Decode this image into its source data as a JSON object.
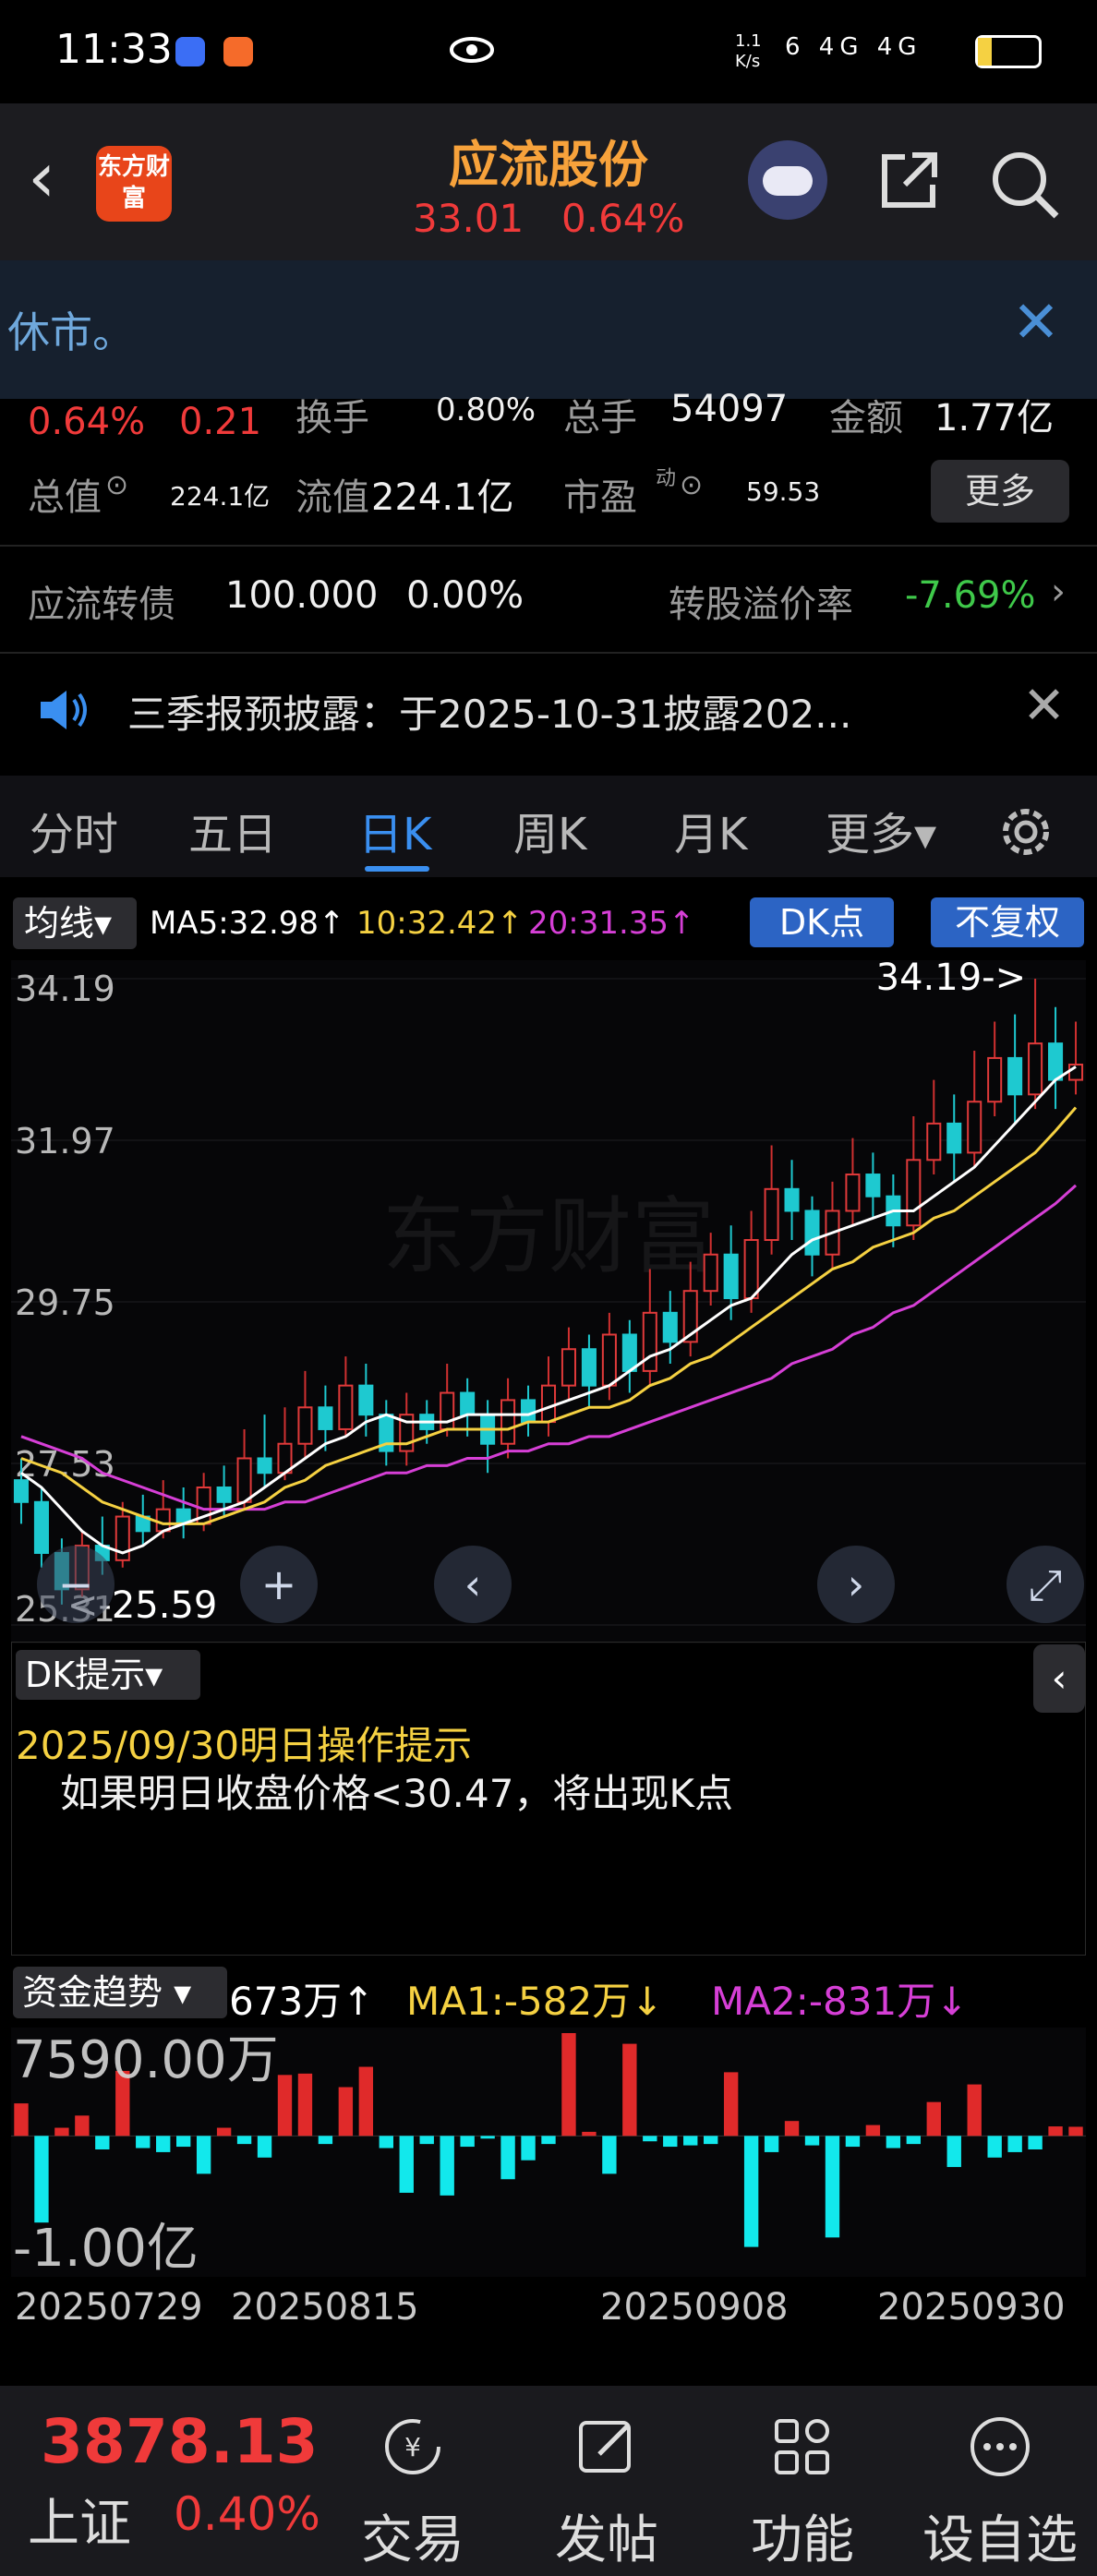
{
  "status_bar": {
    "time": "11:33",
    "net_speed": "1.1 K/s",
    "signal": "6 4G 4G",
    "battery": "20"
  },
  "header": {
    "back_label": "‹",
    "logo_text": "东方财富",
    "stock_name": "应流股份",
    "price": "33.01",
    "change_pct": "0.64%"
  },
  "notice": {
    "text": "休市。",
    "close_label": "✕"
  },
  "quote": {
    "change_pct": "0.64%",
    "change_amt": "0.21",
    "turnover_label": "换手",
    "turnover": "0.80%",
    "volume_label": "总手",
    "volume": "54097",
    "amount_label": "金额",
    "amount": "1.77亿",
    "mktcap_label": "总值",
    "mktcap": "224.1亿",
    "float_label": "流值",
    "float_val": "224.1亿",
    "pe_label": "市盈",
    "pe_sup": "动",
    "pe": "59.53",
    "more_label": "更多"
  },
  "bond": {
    "name": "应流转债",
    "price": "100.000",
    "pct": "0.00%",
    "premium_label": "转股溢价率",
    "premium": "-7.69%",
    "arrow": "›"
  },
  "news": {
    "text": "三季报预披露：于2025-10-31披露202...",
    "close_label": "✕"
  },
  "tabs": [
    {
      "label": "分时"
    },
    {
      "label": "五日"
    },
    {
      "label": "日K"
    },
    {
      "label": "周K"
    },
    {
      "label": "月K"
    },
    {
      "label": "更多▾"
    }
  ],
  "ma_bar": {
    "selector": "均线▾",
    "ma5": "MA5:32.98↑",
    "ma10": "10:32.42↑",
    "ma20": "20:31.35↑",
    "dk_label": "DK点",
    "fq_label": "不复权",
    "colors": {
      "ma5": "#ffffff",
      "ma10": "#f5d142",
      "ma20": "#d63fd6"
    }
  },
  "chart_data": [
    {
      "type": "candlestick",
      "y_ticks": [
        "34.19",
        "31.97",
        "29.75",
        "27.53",
        "25.31"
      ],
      "ylim": [
        25.31,
        34.19
      ],
      "high_label": "34.19->",
      "low_label": "<-25.59",
      "watermark": "东方财富",
      "candles": [
        [
          27.3,
          27.0,
          27.6,
          26.7
        ],
        [
          27.0,
          26.3,
          27.2,
          26.1
        ],
        [
          26.3,
          25.8,
          26.5,
          25.59
        ],
        [
          25.8,
          26.4,
          26.6,
          25.7
        ],
        [
          26.4,
          26.2,
          26.8,
          26.0
        ],
        [
          26.2,
          26.8,
          27.0,
          26.1
        ],
        [
          26.8,
          26.6,
          27.1,
          26.4
        ],
        [
          26.6,
          26.9,
          27.3,
          26.5
        ],
        [
          26.9,
          26.7,
          27.2,
          26.5
        ],
        [
          26.7,
          27.2,
          27.4,
          26.6
        ],
        [
          27.2,
          27.0,
          27.5,
          26.8
        ],
        [
          27.0,
          27.6,
          28.0,
          26.9
        ],
        [
          27.6,
          27.4,
          28.2,
          27.2
        ],
        [
          27.4,
          27.8,
          28.3,
          27.3
        ],
        [
          27.8,
          28.3,
          28.8,
          27.6
        ],
        [
          28.3,
          28.0,
          28.6,
          27.7
        ],
        [
          28.0,
          28.6,
          29.0,
          27.9
        ],
        [
          28.6,
          28.2,
          28.9,
          27.9
        ],
        [
          28.2,
          27.7,
          28.4,
          27.5
        ],
        [
          27.7,
          28.2,
          28.5,
          27.5
        ],
        [
          28.2,
          28.0,
          28.4,
          27.8
        ],
        [
          28.0,
          28.5,
          28.9,
          27.9
        ],
        [
          28.5,
          28.2,
          28.7,
          27.9
        ],
        [
          28.2,
          27.8,
          28.4,
          27.4
        ],
        [
          27.8,
          28.4,
          28.7,
          27.6
        ],
        [
          28.4,
          28.1,
          28.6,
          27.9
        ],
        [
          28.1,
          28.6,
          29.0,
          27.9
        ],
        [
          28.6,
          29.1,
          29.4,
          28.4
        ],
        [
          29.1,
          28.6,
          29.3,
          28.3
        ],
        [
          28.6,
          29.3,
          29.6,
          28.4
        ],
        [
          29.3,
          28.8,
          29.5,
          28.5
        ],
        [
          28.8,
          29.6,
          30.2,
          28.6
        ],
        [
          29.6,
          29.2,
          29.9,
          28.9
        ],
        [
          29.2,
          29.9,
          30.3,
          29.0
        ],
        [
          29.9,
          30.4,
          30.7,
          29.7
        ],
        [
          30.4,
          29.8,
          30.8,
          29.5
        ],
        [
          29.8,
          30.6,
          31.0,
          29.6
        ],
        [
          30.6,
          31.3,
          31.9,
          30.4
        ],
        [
          31.3,
          31.0,
          31.7,
          30.6
        ],
        [
          31.0,
          30.4,
          31.2,
          30.1
        ],
        [
          30.4,
          31.0,
          31.4,
          30.2
        ],
        [
          31.0,
          31.5,
          32.0,
          30.8
        ],
        [
          31.5,
          31.2,
          31.8,
          30.9
        ],
        [
          31.2,
          30.8,
          31.5,
          30.5
        ],
        [
          30.8,
          31.7,
          32.3,
          30.6
        ],
        [
          31.7,
          32.2,
          32.8,
          31.5
        ],
        [
          32.2,
          31.8,
          32.6,
          31.4
        ],
        [
          31.8,
          32.5,
          33.2,
          31.6
        ],
        [
          32.5,
          33.1,
          33.6,
          32.3
        ],
        [
          33.1,
          32.6,
          33.7,
          32.2
        ],
        [
          32.6,
          33.3,
          34.19,
          32.4
        ],
        [
          33.3,
          32.8,
          33.8,
          32.4
        ],
        [
          32.8,
          33.01,
          33.6,
          32.6
        ]
      ],
      "ma5": [
        27.4,
        27.2,
        26.9,
        26.6,
        26.4,
        26.3,
        26.4,
        26.6,
        26.7,
        26.8,
        26.9,
        27.0,
        27.2,
        27.4,
        27.6,
        27.8,
        27.9,
        28.1,
        28.2,
        28.1,
        28.1,
        28.1,
        28.2,
        28.2,
        28.2,
        28.2,
        28.3,
        28.4,
        28.5,
        28.6,
        28.8,
        29.0,
        29.1,
        29.3,
        29.5,
        29.7,
        29.8,
        30.1,
        30.4,
        30.6,
        30.7,
        30.8,
        30.9,
        31.0,
        31.0,
        31.2,
        31.4,
        31.6,
        31.9,
        32.2,
        32.5,
        32.8,
        32.98
      ],
      "ma10": [
        27.6,
        27.5,
        27.4,
        27.2,
        27.0,
        26.9,
        26.8,
        26.7,
        26.7,
        26.7,
        26.8,
        26.9,
        27.0,
        27.2,
        27.3,
        27.5,
        27.6,
        27.7,
        27.8,
        27.8,
        27.9,
        28.0,
        28.0,
        28.0,
        28.0,
        28.1,
        28.1,
        28.2,
        28.3,
        28.3,
        28.4,
        28.6,
        28.7,
        28.9,
        29.0,
        29.2,
        29.4,
        29.6,
        29.8,
        30.0,
        30.2,
        30.3,
        30.5,
        30.6,
        30.7,
        30.9,
        31.0,
        31.2,
        31.4,
        31.6,
        31.8,
        32.1,
        32.42
      ],
      "ma20": [
        27.9,
        27.8,
        27.7,
        27.6,
        27.4,
        27.3,
        27.2,
        27.1,
        27.0,
        26.9,
        26.9,
        26.9,
        26.9,
        27.0,
        27.0,
        27.1,
        27.2,
        27.3,
        27.4,
        27.4,
        27.5,
        27.5,
        27.6,
        27.6,
        27.7,
        27.7,
        27.8,
        27.8,
        27.9,
        27.9,
        28.0,
        28.1,
        28.2,
        28.3,
        28.4,
        28.5,
        28.6,
        28.7,
        28.9,
        29.0,
        29.1,
        29.3,
        29.4,
        29.6,
        29.7,
        29.9,
        30.1,
        30.3,
        30.5,
        30.7,
        30.9,
        31.1,
        31.35
      ]
    },
    {
      "type": "bar",
      "title": "资金趋势",
      "current": "673万↑",
      "ma1_label": "MA1:-582万↓",
      "ma2_label": "MA2:-831万↓",
      "y_ticks": [
        "7590.00万",
        "-1.00亿"
      ],
      "ylim": [
        -10000,
        7590
      ],
      "values": [
        2400,
        -6400,
        600,
        1500,
        -1000,
        4800,
        -900,
        -1200,
        -800,
        -2800,
        600,
        -600,
        -1600,
        4500,
        4600,
        -600,
        3600,
        5100,
        -900,
        -4200,
        -600,
        -4400,
        -800,
        -200,
        -3200,
        -1800,
        -600,
        7590,
        300,
        -2800,
        6800,
        -400,
        -800,
        -700,
        -600,
        4700,
        -8200,
        -1200,
        1100,
        -700,
        -7500,
        -800,
        800,
        -900,
        -600,
        2500,
        -2300,
        3800,
        -1600,
        -1200,
        -1000,
        700,
        673
      ],
      "x_labels": [
        "20250729",
        "20250815",
        "20250908",
        "20250930"
      ]
    }
  ],
  "dk_panel": {
    "selector": "DK提示▾",
    "collapse_label": "‹",
    "date_line": "2025/09/30明日操作提示",
    "hint": "如果明日收盘价格<30.47，将出现K点"
  },
  "bottom": {
    "index_value": "3878.13",
    "index_name": "上证",
    "index_pct": "0.40%",
    "nav": [
      {
        "label": "交易"
      },
      {
        "label": "发帖"
      },
      {
        "label": "功能"
      },
      {
        "label": "设自选"
      }
    ]
  }
}
